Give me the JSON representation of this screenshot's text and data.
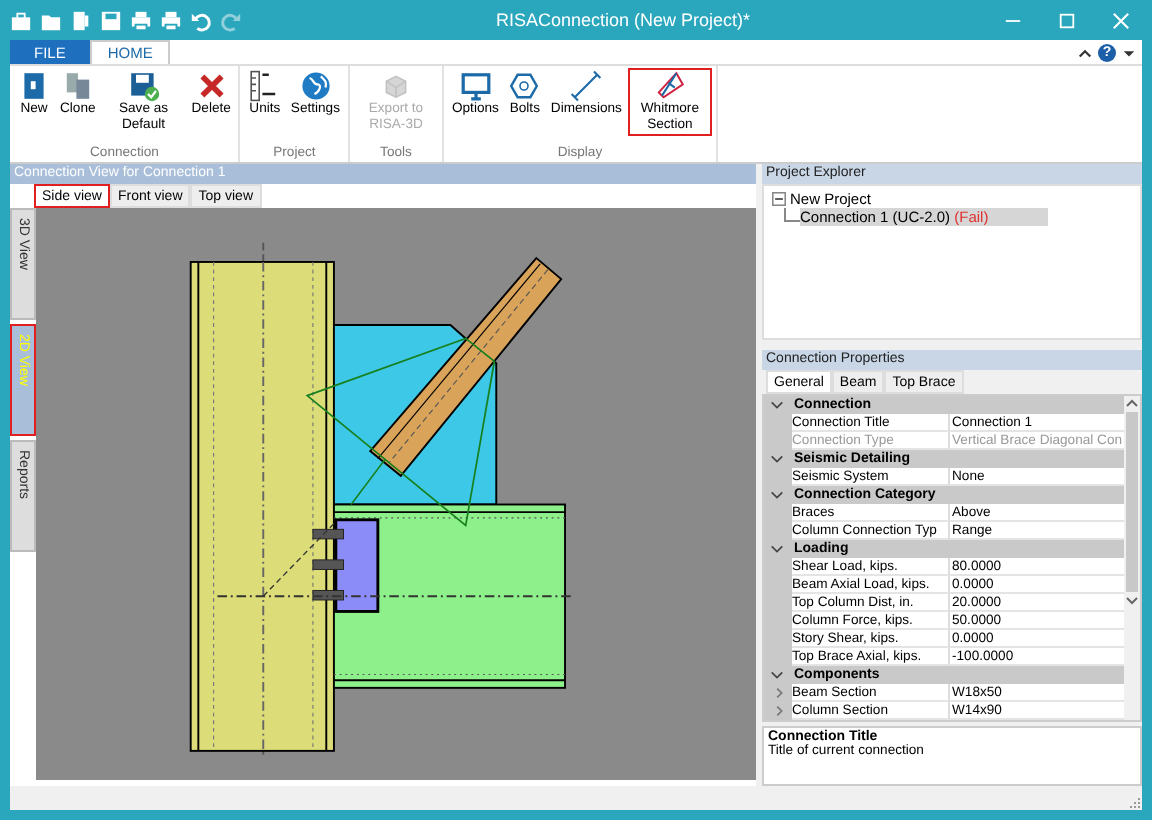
{
  "window": {
    "title": "RISAConnection (New Project)*"
  },
  "ribbon": {
    "tabs": [
      {
        "label": "FILE",
        "kind": "file",
        "selected": false
      },
      {
        "label": "HOME",
        "kind": "tab",
        "selected": true
      }
    ],
    "help": "?",
    "groups": [
      {
        "label": "Connection",
        "buttons": [
          {
            "label": "New",
            "disabled": false,
            "highlighted": false
          },
          {
            "label": "Clone",
            "disabled": false,
            "highlighted": false
          },
          {
            "label": "Save as Default",
            "disabled": false,
            "highlighted": false
          },
          {
            "label": "Delete",
            "disabled": false,
            "highlighted": false
          }
        ]
      },
      {
        "label": "Project",
        "buttons": [
          {
            "label": "Units",
            "disabled": false,
            "highlighted": false
          },
          {
            "label": "Settings",
            "disabled": false,
            "highlighted": false
          }
        ]
      },
      {
        "label": "Tools",
        "buttons": [
          {
            "label": "Export to RISA-3D",
            "disabled": true,
            "highlighted": false
          }
        ]
      },
      {
        "label": "Display",
        "buttons": [
          {
            "label": "Options",
            "disabled": false,
            "highlighted": false
          },
          {
            "label": "Bolts",
            "disabled": false,
            "highlighted": false
          },
          {
            "label": "Dimensions",
            "disabled": false,
            "highlighted": false
          },
          {
            "label": "Whitmore Section",
            "disabled": false,
            "highlighted": true
          }
        ]
      }
    ]
  },
  "view_panel": {
    "title": "Connection View for Connection 1",
    "tabs": [
      {
        "label": "Side view",
        "selected": true,
        "highlighted": true
      },
      {
        "label": "Front view",
        "selected": false,
        "highlighted": false
      },
      {
        "label": "Top view",
        "selected": false,
        "highlighted": false
      }
    ],
    "side_tabs": [
      {
        "label": "3D View",
        "selected": false,
        "highlighted": false
      },
      {
        "label": "2D View",
        "selected": true,
        "highlighted": true
      },
      {
        "label": "Reports",
        "selected": false,
        "highlighted": false
      }
    ]
  },
  "project_explorer": {
    "title": "Project Explorer",
    "tree": [
      {
        "label": "New Project",
        "expanded": true,
        "selected": false,
        "children": [
          {
            "label": "Connection 1 (UC-2.0)",
            "status": "(Fail)",
            "selected": true
          }
        ]
      }
    ]
  },
  "properties": {
    "title": "Connection Properties",
    "tabs": [
      {
        "label": "General",
        "selected": true
      },
      {
        "label": "Beam",
        "selected": false
      },
      {
        "label": "Top Brace",
        "selected": false
      }
    ],
    "categories": [
      {
        "name": "Connection",
        "expanded": true,
        "rows": [
          {
            "name": "Connection Title",
            "value": "Connection 1",
            "disabled": false,
            "expandable": false
          },
          {
            "name": "Connection Type",
            "value": "Vertical Brace Diagonal Con",
            "disabled": true,
            "expandable": false
          }
        ]
      },
      {
        "name": "Seismic Detailing",
        "expanded": true,
        "rows": [
          {
            "name": "Seismic System",
            "value": "None",
            "disabled": false,
            "expandable": false
          }
        ]
      },
      {
        "name": "Connection Category",
        "expanded": true,
        "rows": [
          {
            "name": "Braces",
            "value": "Above",
            "disabled": false,
            "expandable": false
          },
          {
            "name": "Column Connection Typ",
            "value": "Range",
            "disabled": false,
            "expandable": false
          }
        ]
      },
      {
        "name": "Loading",
        "expanded": true,
        "rows": [
          {
            "name": "Shear Load, kips.",
            "value": "80.0000",
            "disabled": false,
            "expandable": false
          },
          {
            "name": "Beam Axial Load, kips.",
            "value": "0.0000",
            "disabled": false,
            "expandable": false
          },
          {
            "name": "Top Column Dist, in.",
            "value": "20.0000",
            "disabled": false,
            "expandable": false
          },
          {
            "name": "Column Force, kips.",
            "value": "50.0000",
            "disabled": false,
            "expandable": false
          },
          {
            "name": "Story Shear, kips.",
            "value": "0.0000",
            "disabled": false,
            "expandable": false
          },
          {
            "name": "Top Brace Axial, kips.",
            "value": "-100.0000",
            "disabled": false,
            "expandable": false
          }
        ]
      },
      {
        "name": "Components",
        "expanded": true,
        "rows": [
          {
            "name": "Beam Section",
            "value": "W18x50",
            "disabled": false,
            "expandable": true
          },
          {
            "name": "Column Section",
            "value": "W14x90",
            "disabled": false,
            "expandable": true
          }
        ]
      }
    ],
    "description": {
      "title": "Connection Title",
      "text": "Title of current connection"
    }
  }
}
